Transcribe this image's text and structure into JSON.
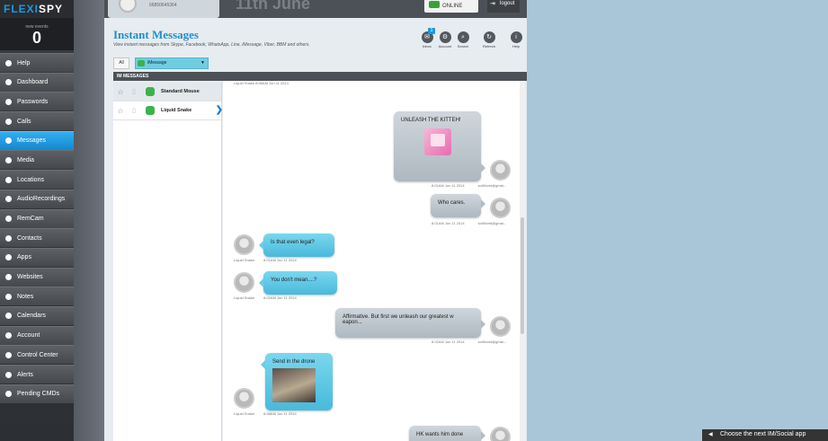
{
  "app": {
    "logo_flexi": "FLEXI",
    "logo_spy": "SPY",
    "events_label": "new events",
    "events_count": "0"
  },
  "nav": [
    {
      "label": "Help",
      "icon": "info-icon",
      "active": false
    },
    {
      "label": "Dashboard",
      "icon": "dashboard-icon",
      "active": false
    },
    {
      "label": "Passwords",
      "icon": "key-icon",
      "active": false
    },
    {
      "label": "Calls",
      "icon": "phone-icon",
      "active": false
    },
    {
      "label": "Messages",
      "icon": "message-icon",
      "active": true
    },
    {
      "label": "Media",
      "icon": "media-icon",
      "active": false
    },
    {
      "label": "Locations",
      "icon": "location-icon",
      "active": false
    },
    {
      "label": "AudioRecordings",
      "icon": "microphone-icon",
      "active": false
    },
    {
      "label": "RemCam",
      "icon": "camera-icon",
      "active": false
    },
    {
      "label": "Contacts",
      "icon": "contacts-icon",
      "active": false
    },
    {
      "label": "Apps",
      "icon": "apps-icon",
      "active": false
    },
    {
      "label": "Websites",
      "icon": "globe-icon",
      "active": false
    },
    {
      "label": "Notes",
      "icon": "notes-icon",
      "active": false
    },
    {
      "label": "Calendars",
      "icon": "calendar-icon",
      "active": false
    },
    {
      "label": "Account",
      "icon": "user-icon",
      "active": false
    },
    {
      "label": "Control Center",
      "icon": "gear-icon",
      "active": false
    },
    {
      "label": "Alerts",
      "icon": "bell-icon",
      "active": false
    },
    {
      "label": "Pending CMDs",
      "icon": "clock-icon",
      "active": false
    }
  ],
  "header": {
    "phone": "66850645364",
    "date": "11th June",
    "status": "ONLINE",
    "logout": "logout"
  },
  "page": {
    "title": "Instant Messages",
    "subtitle": "View instant messages from Skype, Facebook, WhatsApp, Line, iMessage, Viber, BBM and others."
  },
  "toolbar": [
    {
      "label": "Inbox",
      "icon": "inbox-icon",
      "badge": "1"
    },
    {
      "label": "Account",
      "icon": "gear-icon"
    },
    {
      "label": "Search",
      "icon": "search-icon"
    },
    {
      "label": "Refresh",
      "icon": "refresh-icon"
    },
    {
      "label": "Help",
      "icon": "info-icon"
    }
  ],
  "filters": {
    "all": "All",
    "selected": "iMessage"
  },
  "im_header": "IM MESSAGES",
  "conversations": [
    {
      "name": "Standard Mouse",
      "active": true
    },
    {
      "name": "Liquid Snake",
      "active": false
    }
  ],
  "messages": {
    "top_meta": "Liquid Snake     8:05AM Jun 11 2014",
    "items": [
      {
        "text": "UNLEASH THE KITTEH!",
        "direction": "out",
        "time": "8:01AM Jun 11 2014",
        "sender": "solWorld@gmai...",
        "attachment": "unikitty-image"
      },
      {
        "text": "Who cares.",
        "direction": "out",
        "time": "8:01AM Jun 11 2014",
        "sender": "solWorld@gmai..."
      },
      {
        "text": "Is that even legal?",
        "direction": "in",
        "time": "8:01AM Jun 11 2014",
        "sender": "Liquid Snake"
      },
      {
        "text": "You don't mean....?",
        "direction": "in",
        "time": "8:02AM Jun 11 2014",
        "sender": "Liquid Snake"
      },
      {
        "text": "Affirmative. But first we unleash our greatest w eapon...",
        "direction": "out",
        "time": "8:02AM Jun 11 2014",
        "sender": "solWorld@gmai..."
      },
      {
        "text": "Send in the drone",
        "direction": "in",
        "time": "8:58AM Jun 11 2014",
        "sender": "Liquid Snake",
        "attachment": "drone-image"
      },
      {
        "text": "HK wants him done",
        "direction": "out",
        "time": "8:58AM Jun 11 2014",
        "sender": "solWorld@gmai..."
      }
    ]
  },
  "footer_button": "Choose the next IM/Social app"
}
